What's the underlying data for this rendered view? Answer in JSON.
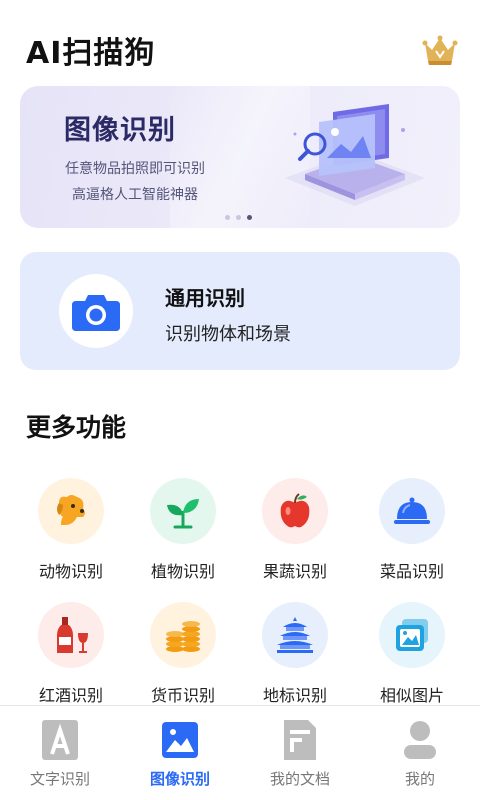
{
  "app": {
    "title": "AI扫描狗"
  },
  "header": {
    "vip_icon": "crown-icon"
  },
  "banner": {
    "title": "图像识别",
    "subtitle_line1": "任意物品拍照即可识别",
    "subtitle_line2": "高逼格人工智能神器",
    "illustration": "image-scan-illustration",
    "carousel_total": 3,
    "carousel_active": 3
  },
  "main_card": {
    "icon": "camera-icon",
    "title": "通用识别",
    "subtitle": "识别物体和场景"
  },
  "more_section": {
    "title": "更多功能",
    "features": [
      {
        "label": "动物识别",
        "icon": "dog-icon",
        "bg": "#fff3e0"
      },
      {
        "label": "植物识别",
        "icon": "sprout-icon",
        "bg": "#e4f7ee"
      },
      {
        "label": "果蔬识别",
        "icon": "apple-icon",
        "bg": "#fdecea"
      },
      {
        "label": "菜品识别",
        "icon": "food-cover-icon",
        "bg": "#e7eefc"
      },
      {
        "label": "红酒识别",
        "icon": "wine-icon",
        "bg": "#fdecea"
      },
      {
        "label": "货币识别",
        "icon": "coins-icon",
        "bg": "#fff3e0"
      },
      {
        "label": "地标识别",
        "icon": "temple-icon",
        "bg": "#e7eefc"
      },
      {
        "label": "相似图片",
        "icon": "photos-icon",
        "bg": "#e6f4fb"
      }
    ]
  },
  "tabbar": {
    "active_index": 1,
    "tabs": [
      {
        "label": "文字识别",
        "icon": "text-a-icon"
      },
      {
        "label": "图像识别",
        "icon": "image-icon"
      },
      {
        "label": "我的文档",
        "icon": "document-icon"
      },
      {
        "label": "我的",
        "icon": "user-icon"
      }
    ]
  },
  "colors": {
    "accent": "#2a6af5",
    "banner_title": "#2b2a66",
    "tab_inactive": "#777777",
    "main_card_bg": "#e3ebfd"
  }
}
